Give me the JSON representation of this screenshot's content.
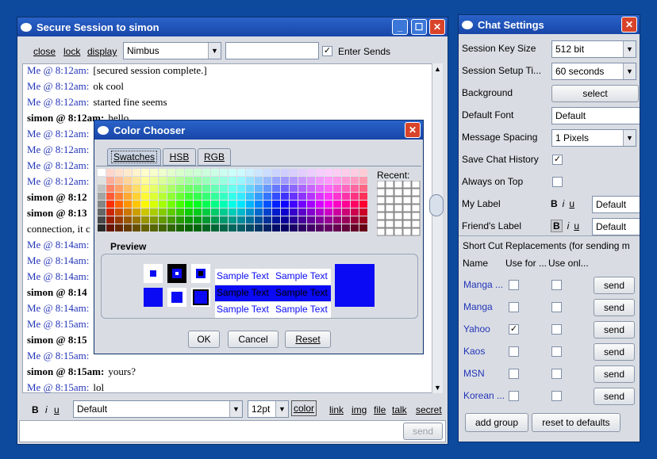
{
  "session": {
    "title": "Secure Session to simon",
    "toolbar": {
      "close": "close",
      "lock": "lock",
      "display": "display",
      "theme": "Nimbus",
      "enter_sends": "Enter Sends"
    },
    "messages": [
      {
        "who": "Me @ 8:12am:",
        "text": "[secured session complete.]",
        "self": true
      },
      {
        "who": "Me @ 8:12am:",
        "text": "ok cool",
        "self": true
      },
      {
        "who": "Me @ 8:12am:",
        "text": "started fine seems",
        "self": true
      },
      {
        "who": "simon @ 8:12am:",
        "text": "hello",
        "self": false
      },
      {
        "who": "Me @ 8:12am:",
        "text": "",
        "self": true
      },
      {
        "who": "Me @ 8:12am:",
        "text": "",
        "self": true
      },
      {
        "who": "Me @ 8:12am:",
        "text": "",
        "self": true
      },
      {
        "who": "Me @ 8:12am:",
        "text": "",
        "self": true
      },
      {
        "who": "simon @ 8:12",
        "text": "",
        "self": false
      },
      {
        "who": "simon @ 8:13",
        "text": "",
        "self": false
      },
      {
        "who": "connection, it c",
        "text": "",
        "self": null
      },
      {
        "who": "Me @ 8:14am:",
        "text": "",
        "self": true
      },
      {
        "who": "Me @ 8:14am:",
        "text": "",
        "self": true
      },
      {
        "who": "Me @ 8:14am:",
        "text": "",
        "self": true
      },
      {
        "who": "simon @ 8:14",
        "text": "",
        "self": false
      },
      {
        "who": "Me @ 8:14am:",
        "text": "",
        "self": true
      },
      {
        "who": "Me @ 8:15am:",
        "text": "",
        "self": true
      },
      {
        "who": "simon @ 8:15",
        "text": "",
        "self": false
      },
      {
        "who": "Me @ 8:15am:",
        "text": "",
        "self": true
      },
      {
        "who": "simon @ 8:15am:",
        "text": "yours?",
        "self": false
      },
      {
        "who": "Me @ 8:15am:",
        "text": "lol",
        "self": true
      }
    ],
    "format": {
      "bold": "B",
      "italic": "i",
      "underline": "u",
      "font": "Default",
      "size": "12pt",
      "color": "color",
      "link": "link",
      "img": "img",
      "file": "file",
      "talk": "talk",
      "secret": "secret"
    },
    "send": "send"
  },
  "color_chooser": {
    "title": "Color Chooser",
    "tabs": [
      "Swatches",
      "HSB",
      "RGB"
    ],
    "recent": "Recent:",
    "preview": "Preview",
    "sample": "Sample Text",
    "ok": "OK",
    "cancel": "Cancel",
    "reset": "Reset",
    "selected_color": "#0a0af5"
  },
  "settings": {
    "title": "Chat Settings",
    "rows": [
      {
        "label": "Session Key Size",
        "value": "512 bit"
      },
      {
        "label": "Session Setup Ti...",
        "value": "60 seconds"
      },
      {
        "label": "Background",
        "value": "select"
      },
      {
        "label": "Default Font",
        "value": "Default"
      },
      {
        "label": "Message Spacing",
        "value": "1 Pixels"
      },
      {
        "label": "Save Chat History",
        "value": "✓"
      },
      {
        "label": "Always on Top",
        "value": ""
      },
      {
        "label": "My Label",
        "value": "Default"
      },
      {
        "label": "Friend's Label",
        "value": "Default"
      }
    ],
    "shortcut_header": "Short Cut Replacements (for sending m",
    "cols": [
      "Name",
      "Use for ...",
      "Use onl..."
    ],
    "groups": [
      {
        "name": "Manga ...",
        "use_for": false,
        "use_only": false,
        "send": "send"
      },
      {
        "name": "Manga",
        "use_for": false,
        "use_only": false,
        "send": "send"
      },
      {
        "name": "Yahoo",
        "use_for": true,
        "use_only": false,
        "send": "send"
      },
      {
        "name": "Kaos",
        "use_for": false,
        "use_only": false,
        "send": "send"
      },
      {
        "name": "MSN",
        "use_for": false,
        "use_only": false,
        "send": "send"
      },
      {
        "name": "Korean ...",
        "use_for": false,
        "use_only": false,
        "send": "send"
      }
    ],
    "add_group": "add group",
    "reset_defaults": "reset to defaults",
    "fmt": {
      "b": "B",
      "i": "i",
      "u": "u"
    }
  }
}
